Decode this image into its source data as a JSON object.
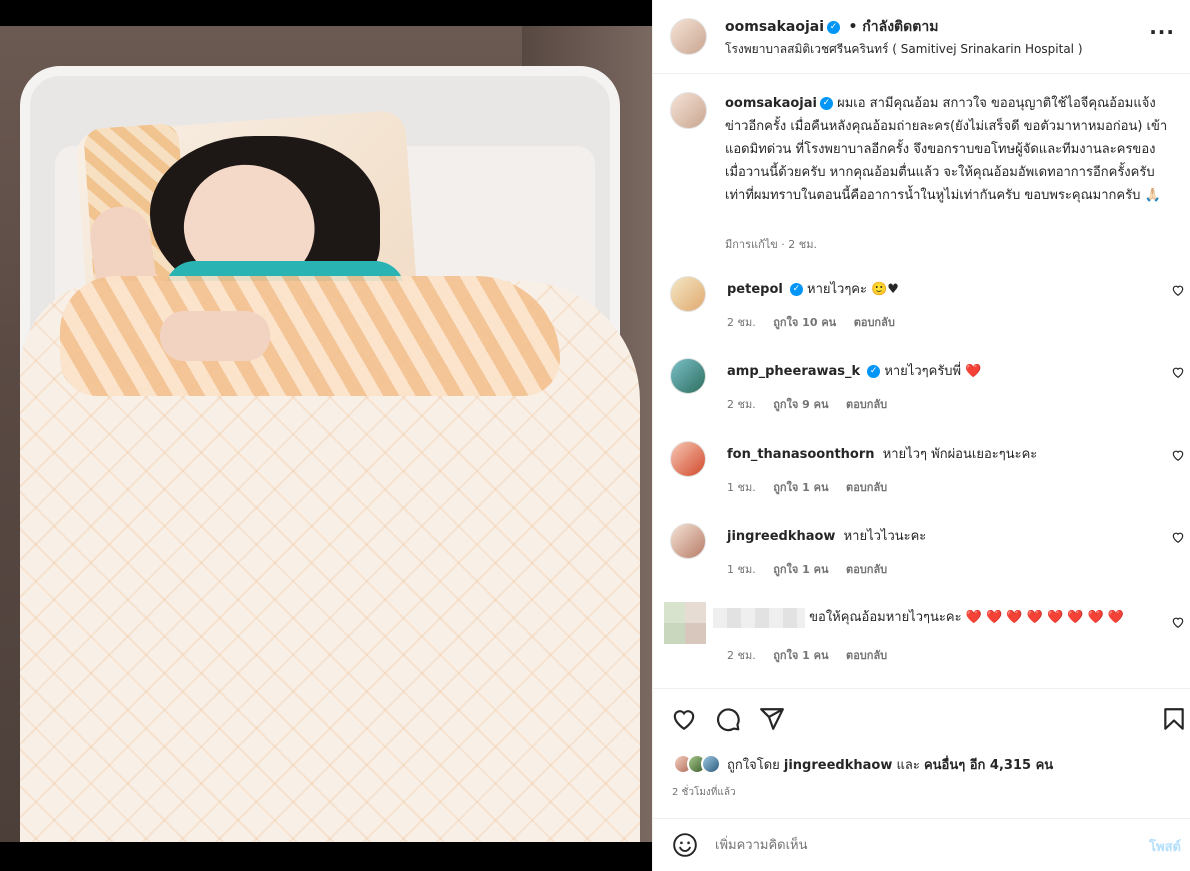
{
  "post": {
    "username": "oomsakaojai",
    "follow_status": "• กำลังติดตาม",
    "location": "โรงพยาบาลสมิติเวชศรีนครินทร์ ( Samitivej Srinakarin Hospital )",
    "more_label": "···",
    "verified_icon": "verified-badge-icon"
  },
  "caption": {
    "username": "oomsakaojai",
    "text": "ผมเอ สามีคุณอ้อม สกาวใจ ขออนุญาติใช้ไอจีคุณอ้อมแจ้งข่าวอีกครั้ง เมื่อคืนหลังคุณอ้อมถ่ายละคร(ยังไม่เสร็จดี ขอตัวมาหาหมอก่อน) เข้าแอดมิทด่วน ที่โรงพยาบาลอีกครั้ง จึงขอกราบขอโทษผู้จัดและทีมงานละครของเมื่อวานนี้ด้วยครับ หากคุณอ้อมตื่นแล้ว จะให้คุณอ้อมอัพเดทอาการอีกครั้งครับ เท่าที่ผมทราบในตอนนี้คืออาการน้ำในหูไม่เท่ากันครับ ขอบพระคุณมากครับ 🙏🏻",
    "meta": "มีการแก้ไข · 2 ชม."
  },
  "comments": [
    {
      "username": "petepol",
      "verified": true,
      "text": "หายไวๆคะ 🙂♥",
      "time": "2 ชม.",
      "likes": "ถูกใจ 10 คน",
      "reply": "ตอบกลับ"
    },
    {
      "username": "amp_pheerawas_k",
      "verified": true,
      "text": "หายไวๆครับพี่ ❤️",
      "time": "2 ชม.",
      "likes": "ถูกใจ 9 คน",
      "reply": "ตอบกลับ"
    },
    {
      "username": "fon_thanasoonthorn",
      "verified": false,
      "text": "หายไวๆ พักผ่อนเยอะๆนะคะ",
      "time": "1 ชม.",
      "likes": "ถูกใจ 1 คน",
      "reply": "ตอบกลับ"
    },
    {
      "username": "jingreedkhaow",
      "verified": false,
      "text": "หายไวไวนะคะ",
      "time": "1 ชม.",
      "likes": "ถูกใจ 1 คน",
      "reply": "ตอบกลับ"
    },
    {
      "username": "",
      "verified": false,
      "text": "ขอให้คุณอ้อมหายไวๆนะคะ ❤️ ❤️ ❤️ ❤️ ❤️ ❤️ ❤️ ❤️",
      "time": "2 ชม.",
      "likes": "ถูกใจ 1 คน",
      "reply": "ตอบกลับ"
    }
  ],
  "actions": {
    "like_icon": "heart-icon",
    "comment_icon": "comment-icon",
    "share_icon": "send-icon",
    "save_icon": "bookmark-icon"
  },
  "likes": {
    "prefix": "ถูกใจโดย",
    "user": "jingreedkhaow",
    "middle": "และ",
    "others": "คนอื่นๆ อีก 4,315 คน"
  },
  "time_ago": "2 ชั่วโมงที่แล้ว",
  "comment_box": {
    "placeholder": "เพิ่มความคิดเห็น",
    "post_label": "โพสต์"
  }
}
